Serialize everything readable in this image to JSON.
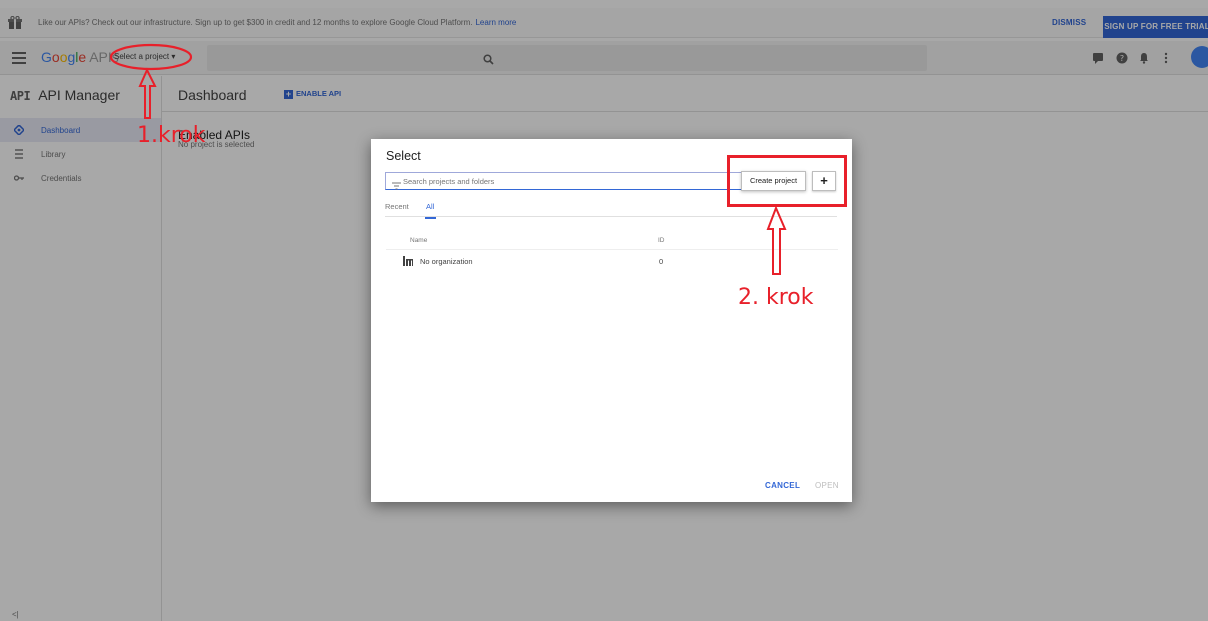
{
  "banner": {
    "message": "Like our APIs? Check out our infrastructure. Sign up to get $300 in credit and 12 months to explore Google Cloud Platform.",
    "learn_more": "Learn more",
    "dismiss": "DISMISS",
    "signup": "SIGN UP FOR FREE TRIAL"
  },
  "topbar": {
    "brand_letters": [
      "G",
      "o",
      "o",
      "g",
      "l",
      "e"
    ],
    "brand_suffix": "APIs",
    "project_selector": "Select a project"
  },
  "sidebar": {
    "header_badge": "API",
    "header_title": "API Manager",
    "items": [
      {
        "label": "Dashboard",
        "icon": "dashboard-icon",
        "active": true
      },
      {
        "label": "Library",
        "icon": "library-icon",
        "active": false
      },
      {
        "label": "Credentials",
        "icon": "key-icon",
        "active": false
      }
    ],
    "collapse": "<|"
  },
  "main": {
    "title": "Dashboard",
    "enable_api": "ENABLE API",
    "subtitle": "Enabled APIs",
    "note": "No project is selected"
  },
  "dialog": {
    "title": "Select",
    "search_placeholder": "Search projects and folders",
    "create_tooltip": "Create project",
    "plus_label": "+",
    "tabs": [
      {
        "label": "Recent",
        "active": false
      },
      {
        "label": "All",
        "active": true
      }
    ],
    "columns": {
      "name": "Name",
      "id": "ID"
    },
    "rows": [
      {
        "name": "No organization",
        "id": "0"
      }
    ],
    "cancel": "CANCEL",
    "open": "OPEN"
  },
  "annotations": {
    "step1": "1.krok",
    "step2": "2. krok",
    "color": "#e8202a"
  },
  "colors": {
    "accent": "#3367d6",
    "annotation": "#e8202a"
  }
}
